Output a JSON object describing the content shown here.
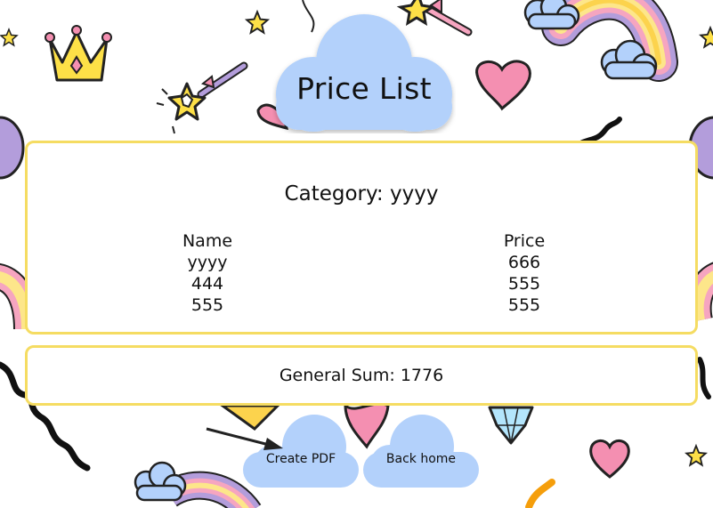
{
  "page": {
    "title": "Price List",
    "category_label": "Category:",
    "category_value": "yyyy",
    "table": {
      "headers": [
        "Name",
        "Price"
      ],
      "rows": [
        {
          "name": "yyyy",
          "price": "666"
        },
        {
          "name": "444",
          "price": "555"
        },
        {
          "name": "555",
          "price": "555"
        }
      ]
    },
    "sum_label": "General Sum:",
    "sum_value": "1776"
  },
  "buttons": {
    "create_pdf": "Create PDF",
    "back_home": "Back home"
  },
  "colors": {
    "cloud": "#b3d1fb",
    "panel_border": "#f5dc62",
    "heart": "#f48fb1",
    "star": "#fde047",
    "rainbow_pink": "#f6a5c0",
    "rainbow_yellow": "#fde68a",
    "rainbow_purple": "#b39ddb"
  }
}
